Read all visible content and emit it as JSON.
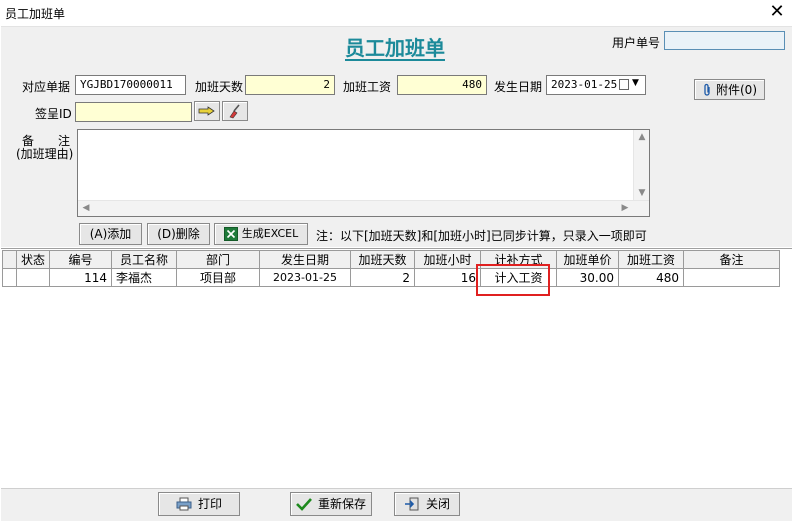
{
  "window": {
    "title": "员工加班单",
    "close_glyph": "✕"
  },
  "form": {
    "title": "员工加班单",
    "user_no_label": "用户单号",
    "user_no_value": "",
    "order_label": "对应单据",
    "order_value": "YGJBD170000011",
    "days_label": "加班天数",
    "days_value": "2",
    "wage_label": "加班工资",
    "wage_value": "480",
    "date_label": "发生日期",
    "date_value": "2023-01-25",
    "attach_label": "附件(0)",
    "sign_label": "签呈ID",
    "sign_value": "",
    "remark_label_1": "备　　注",
    "remark_label_2": "(加班理由)",
    "remark_value": ""
  },
  "actions": {
    "add_label": "(A)添加",
    "delete_label": "(D)删除",
    "excel_label": "生成EXCEL",
    "note": "注：以下[加班天数]和[加班小时]已同步计算，只录入一项即可"
  },
  "table": {
    "columns": [
      "状态",
      "编号",
      "员工名称",
      "部门",
      "发生日期",
      "加班天数",
      "加班小时",
      "计补方式",
      "加班单价",
      "加班工资",
      "备注"
    ],
    "rows": [
      {
        "status": "",
        "id": "114",
        "name": "李福杰",
        "dept": "项目部",
        "date": "2023-01-25",
        "days": "2",
        "hours": "16",
        "method": "计入工资",
        "unit_price": "30.00",
        "wage": "480",
        "remark": ""
      }
    ]
  },
  "footer": {
    "print_label": "打印",
    "save_label": "重新保存",
    "close_label": "关闭"
  },
  "colors": {
    "title_teal": "#1c8a9a",
    "field_yellow": "#ffffd4",
    "highlight_red": "#e02020"
  }
}
